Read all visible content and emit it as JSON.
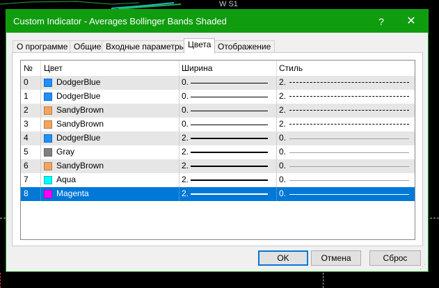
{
  "background": {
    "chart_label": "W S1"
  },
  "dialog": {
    "title": "Custom Indicator - Averages Bollinger Bands Shaded",
    "help_glyph": "?",
    "close_glyph": "✕"
  },
  "tabs": [
    {
      "label": "О программе"
    },
    {
      "label": "Общие"
    },
    {
      "label": "Входные параметры"
    },
    {
      "label": "Цвета"
    },
    {
      "label": "Отображение"
    }
  ],
  "table": {
    "headers": {
      "num": "№",
      "color": "Цвет",
      "width": "Ширина",
      "style": "Стиль"
    },
    "rows": [
      {
        "num": "0",
        "color_name": "DodgerBlue",
        "swatch": "#1e90ff",
        "width": "0.",
        "style": "2.",
        "line_weight": 1,
        "line_kind": "dashed"
      },
      {
        "num": "1",
        "color_name": "DodgerBlue",
        "swatch": "#1e90ff",
        "width": "0.",
        "style": "2.",
        "line_weight": 1,
        "line_kind": "dashed"
      },
      {
        "num": "2",
        "color_name": "SandyBrown",
        "swatch": "#f4a460",
        "width": "0.",
        "style": "2.",
        "line_weight": 1,
        "line_kind": "dashed"
      },
      {
        "num": "3",
        "color_name": "SandyBrown",
        "swatch": "#f4a460",
        "width": "0.",
        "style": "2.",
        "line_weight": 1,
        "line_kind": "dashed"
      },
      {
        "num": "4",
        "color_name": "DodgerBlue",
        "swatch": "#1e90ff",
        "width": "2.",
        "style": "0.",
        "line_weight": 2,
        "line_kind": "solid"
      },
      {
        "num": "5",
        "color_name": "Gray",
        "swatch": "#808080",
        "width": "2.",
        "style": "0.",
        "line_weight": 2,
        "line_kind": "solid"
      },
      {
        "num": "6",
        "color_name": "SandyBrown",
        "swatch": "#f4a460",
        "width": "2.",
        "style": "0.",
        "line_weight": 2,
        "line_kind": "solid"
      },
      {
        "num": "7",
        "color_name": "Aqua",
        "swatch": "#00ffff",
        "width": "2.",
        "style": "0.",
        "line_weight": 2,
        "line_kind": "solid"
      },
      {
        "num": "8",
        "color_name": "Magenta",
        "swatch": "#ff00ff",
        "width": "2.",
        "style": "0.",
        "line_weight": 2,
        "line_kind": "solid",
        "selected": true
      }
    ]
  },
  "buttons": {
    "ok": "OK",
    "cancel": "Отмена",
    "reset": "Сброс"
  },
  "colors": {
    "titlebar": "#0f9d0f",
    "selection": "#0078d7"
  }
}
